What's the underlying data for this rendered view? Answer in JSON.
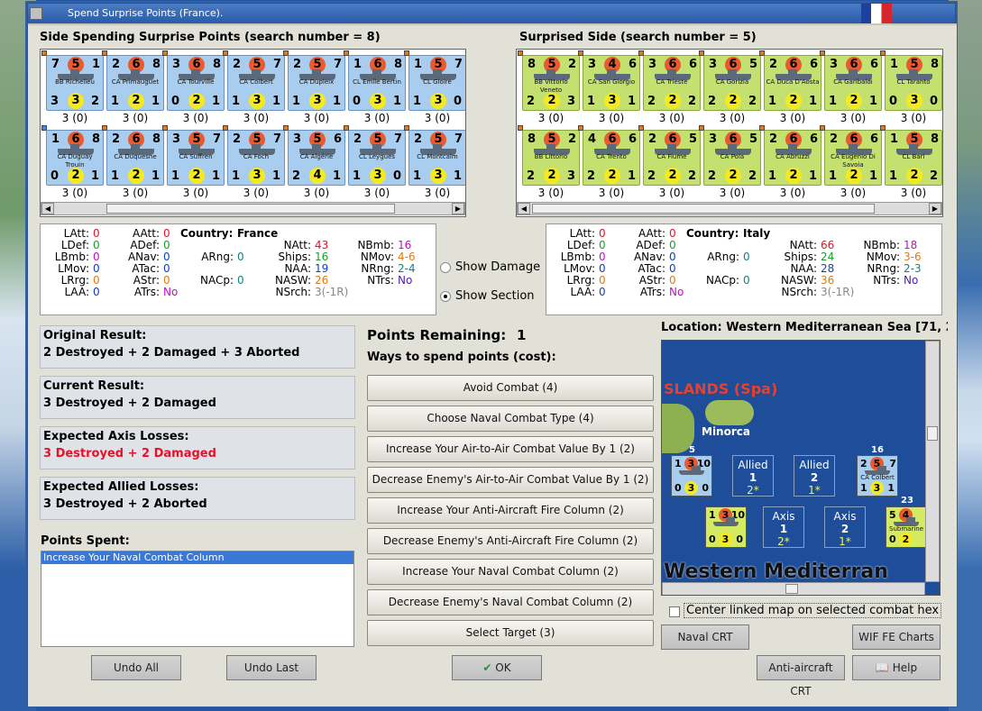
{
  "window": {
    "title": "Spend Surprise Points (France)."
  },
  "left_side": {
    "title": "Side Spending Surprise Points (search number = 8)",
    "units": [
      {
        "tl": "7",
        "c": "5",
        "tr": "1",
        "name": "BB Richelieu",
        "bl": "3",
        "bc": "3",
        "br": "2",
        "count": "3 (0)"
      },
      {
        "tl": "2",
        "c": "6",
        "tr": "8",
        "name": "CA Primauguet",
        "bl": "1",
        "bc": "2",
        "br": "1",
        "count": "3 (0)"
      },
      {
        "tl": "3",
        "c": "6",
        "tr": "8",
        "name": "CA Tourville",
        "bl": "0",
        "bc": "2",
        "br": "1",
        "count": "3 (0)"
      },
      {
        "tl": "2",
        "c": "5",
        "tr": "7",
        "name": "CA Colbert",
        "bl": "1",
        "bc": "3",
        "br": "1",
        "count": "3 (0)"
      },
      {
        "tl": "2",
        "c": "5",
        "tr": "7",
        "name": "CA Dupleix",
        "bl": "1",
        "bc": "3",
        "br": "1",
        "count": "3 (0)"
      },
      {
        "tl": "1",
        "c": "6",
        "tr": "8",
        "name": "CL Emile Bertin",
        "bl": "0",
        "bc": "3",
        "br": "1",
        "count": "3 (0)"
      },
      {
        "tl": "1",
        "c": "5",
        "tr": "7",
        "name": "CL Gloire",
        "bl": "1",
        "bc": "3",
        "br": "0",
        "count": "3 (0)"
      },
      {
        "tl": "1",
        "c": "6",
        "tr": "8",
        "name": "CA Duguay Trouin",
        "bl": "0",
        "bc": "2",
        "br": "1",
        "count": "3 (0)"
      },
      {
        "tl": "2",
        "c": "6",
        "tr": "8",
        "name": "CA Duquesne",
        "bl": "1",
        "bc": "2",
        "br": "1",
        "count": "3 (0)"
      },
      {
        "tl": "3",
        "c": "5",
        "tr": "7",
        "name": "CA Suffren",
        "bl": "1",
        "bc": "2",
        "br": "1",
        "count": "3 (0)"
      },
      {
        "tl": "2",
        "c": "5",
        "tr": "7",
        "name": "CA Foch",
        "bl": "1",
        "bc": "3",
        "br": "1",
        "count": "3 (0)"
      },
      {
        "tl": "3",
        "c": "5",
        "tr": "6",
        "name": "CA Algérie",
        "bl": "2",
        "bc": "4",
        "br": "1",
        "count": "3 (0)"
      },
      {
        "tl": "2",
        "c": "5",
        "tr": "7",
        "name": "CL Leygues",
        "bl": "1",
        "bc": "3",
        "br": "0",
        "count": "3 (0)"
      },
      {
        "tl": "2",
        "c": "5",
        "tr": "7",
        "name": "CL Montcalm",
        "bl": "1",
        "bc": "3",
        "br": "1",
        "count": "3 (0)"
      }
    ],
    "stats": {
      "latt": "0",
      "ldef": "0",
      "lbmb": "0",
      "lmov": "0",
      "lrrg": "0",
      "laa": "0",
      "aatt": "0",
      "adef": "0",
      "anav": "0",
      "atac": "0",
      "astr": "0",
      "atrs": "No",
      "country_label": "Country:",
      "country": "France",
      "arng": "0",
      "nacp": "0",
      "natt": "43",
      "ships": "16",
      "naa": "19",
      "nasw": "26",
      "nsrch": "3(-1R)",
      "nbmb": "16",
      "nmov": "4-6",
      "nrng": "2-4",
      "ntrs": "No"
    }
  },
  "right_side": {
    "title": "Surprised Side (search number = 5)",
    "units": [
      {
        "tl": "8",
        "c": "5",
        "tr": "2",
        "name": "BB Vittorio Veneto",
        "bl": "2",
        "bc": "2",
        "br": "3",
        "count": "3 (0)"
      },
      {
        "tl": "3",
        "c": "4",
        "tr": "6",
        "name": "CA San Giorgio",
        "bl": "1",
        "bc": "3",
        "br": "1",
        "count": "3 (0)"
      },
      {
        "tl": "3",
        "c": "6",
        "tr": "6",
        "name": "CA Trieste",
        "bl": "2",
        "bc": "2",
        "br": "2",
        "count": "3 (0)"
      },
      {
        "tl": "3",
        "c": "6",
        "tr": "5",
        "name": "CA Gorizia",
        "bl": "2",
        "bc": "2",
        "br": "2",
        "count": "3 (0)"
      },
      {
        "tl": "2",
        "c": "6",
        "tr": "6",
        "name": "CA Duca D'Aosta",
        "bl": "1",
        "bc": "2",
        "br": "1",
        "count": "3 (0)"
      },
      {
        "tl": "3",
        "c": "6",
        "tr": "6",
        "name": "CA Garibaldi",
        "bl": "1",
        "bc": "2",
        "br": "1",
        "count": "3 (0)"
      },
      {
        "tl": "1",
        "c": "5",
        "tr": "8",
        "name": "CL Taranto",
        "bl": "0",
        "bc": "3",
        "br": "0",
        "count": "3 (0)"
      },
      {
        "tl": "8",
        "c": "5",
        "tr": "2",
        "name": "BB Littorio",
        "bl": "2",
        "bc": "2",
        "br": "3",
        "count": "3 (0)"
      },
      {
        "tl": "4",
        "c": "6",
        "tr": "6",
        "name": "CA Trento",
        "bl": "2",
        "bc": "2",
        "br": "1",
        "count": "3 (0)"
      },
      {
        "tl": "2",
        "c": "6",
        "tr": "5",
        "name": "CA Fiume",
        "bl": "2",
        "bc": "2",
        "br": "2",
        "count": "3 (0)"
      },
      {
        "tl": "3",
        "c": "6",
        "tr": "5",
        "name": "CA Pola",
        "bl": "2",
        "bc": "2",
        "br": "2",
        "count": "3 (0)"
      },
      {
        "tl": "2",
        "c": "6",
        "tr": "6",
        "name": "CA Abruzzi",
        "bl": "1",
        "bc": "2",
        "br": "1",
        "count": "3 (0)"
      },
      {
        "tl": "2",
        "c": "6",
        "tr": "6",
        "name": "CA Eugenio Di Savoia",
        "bl": "1",
        "bc": "2",
        "br": "1",
        "count": "3 (0)"
      },
      {
        "tl": "1",
        "c": "5",
        "tr": "8",
        "name": "CL Bari",
        "bl": "1",
        "bc": "2",
        "br": "2",
        "count": "3 (0)"
      }
    ],
    "stats": {
      "latt": "0",
      "ldef": "0",
      "lbmb": "0",
      "lmov": "0",
      "lrrg": "0",
      "laa": "0",
      "aatt": "0",
      "adef": "0",
      "anav": "0",
      "atac": "0",
      "astr": "0",
      "atrs": "No",
      "country_label": "Country:",
      "country": "Italy",
      "arng": "0",
      "nacp": "0",
      "natt": "66",
      "ships": "24",
      "naa": "28",
      "nasw": "36",
      "nsrch": "3(-1R)",
      "nbmb": "18",
      "nmov": "3-6",
      "nrng": "2-3",
      "ntrs": "No"
    }
  },
  "stat_labels": {
    "latt": "LAtt:",
    "ldef": "LDef:",
    "lbmb": "LBmb:",
    "lmov": "LMov:",
    "lrrg": "LRrg:",
    "laa": "LAA:",
    "aatt": "AAtt:",
    "adef": "ADef:",
    "anav": "ANav:",
    "atac": "ATac:",
    "astr": "AStr:",
    "atrs": "ATrs:",
    "arng": "ARng:",
    "nacp": "NACp:",
    "natt": "NAtt:",
    "ships": "Ships:",
    "naa": "NAA:",
    "nasw": "NASW:",
    "nsrch": "NSrch:",
    "nbmb": "NBmb:",
    "nmov": "NMov:",
    "nrng": "NRng:",
    "ntrs": "NTrs:"
  },
  "options": {
    "show_damage": "Show Damage",
    "show_section": "Show Section",
    "selected": "show_section"
  },
  "results": {
    "original_label": "Original Result:",
    "original": "2 Destroyed + 2 Damaged + 3 Aborted",
    "current_label": "Current Result:",
    "current": "3 Destroyed + 2 Damaged",
    "axis_label": "Expected Axis Losses:",
    "axis": "3 Destroyed + 2 Damaged",
    "allied_label": "Expected Allied Losses:",
    "allied": "3 Destroyed + 2 Aborted",
    "axis_color": "#e8102a"
  },
  "points_spent": {
    "label": "Points Spent:",
    "items": [
      "Increase Your Naval Combat Column"
    ]
  },
  "points_remaining": {
    "label": "Points Remaining:",
    "value": "1"
  },
  "ways_label": "Ways to spend points (cost):",
  "ways": [
    "Avoid Combat (4)",
    "Choose Naval Combat Type (4)",
    "Increase Your Air-to-Air Combat Value By 1 (2)",
    "Decrease Enemy's Air-to-Air Combat Value By 1 (2)",
    "Increase Your Anti-Aircraft Fire Column (2)",
    "Decrease Enemy's Anti-Aircraft Fire Column (2)",
    "Increase Your Naval Combat Column (2)",
    "Decrease Enemy's Naval Combat Column (2)",
    "Select Target (3)"
  ],
  "location": {
    "label": "Location: Western Mediterranean Sea [71, 2"
  },
  "map": {
    "islands_label": "SLANDS (Spa)",
    "minorca": "Minorca",
    "sea_label": "Western Mediterran",
    "stack1_count": "5",
    "stack2_count": "16",
    "stack3_count": "23",
    "u1": {
      "tl": "1",
      "c": "3",
      "tr": "10",
      "bl": "0",
      "bc": "3",
      "br": "0"
    },
    "u2": {
      "tl": "2",
      "c": "5",
      "tr": "7",
      "name": "CA Colbert",
      "bl": "1",
      "bc": "3",
      "br": "1"
    },
    "u3": {
      "tl": "1",
      "c": "3",
      "tr": "10",
      "bl": "0",
      "bc": "3",
      "br": "0"
    },
    "u4": {
      "tl": "5",
      "c": "4",
      "tr": "",
      "name": "Submarine",
      "bl": "0",
      "bc": "2",
      "br": ""
    },
    "allied1": {
      "side": "Allied",
      "num": "1",
      "star": "2*"
    },
    "allied2": {
      "side": "Allied",
      "num": "2",
      "star": "1*"
    },
    "axis1": {
      "side": "Axis",
      "num": "1",
      "star": "2*"
    },
    "axis2": {
      "side": "Axis",
      "num": "2",
      "star": "1*"
    }
  },
  "center_linked": "Center linked map on selected combat hex",
  "buttons": {
    "naval_crt": "Naval CRT",
    "wif_charts": "WIF FE Charts",
    "aa_crt": "Anti-aircraft CRT",
    "help": "Help",
    "undo_all": "Undo All",
    "undo_last": "Undo Last",
    "ok": "OK"
  }
}
